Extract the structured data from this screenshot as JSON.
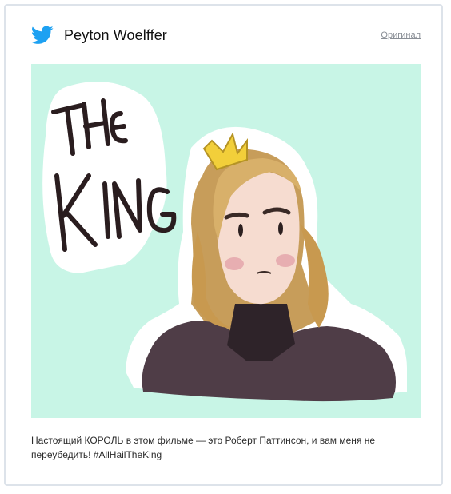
{
  "tweet": {
    "author": "Peyton Woelffer",
    "original_link": "Оригинал",
    "text": "Настоящий КОРОЛЬ в этом фильме — это Роберт Паттинсон, и вам меня не переубедить! #AllHailTheKing"
  },
  "image": {
    "lettering": "THE KING",
    "background_color": "#c8f5e6"
  },
  "colors": {
    "twitter_blue": "#1da1f2"
  },
  "icons": {
    "brand": "twitter-bird-icon"
  }
}
